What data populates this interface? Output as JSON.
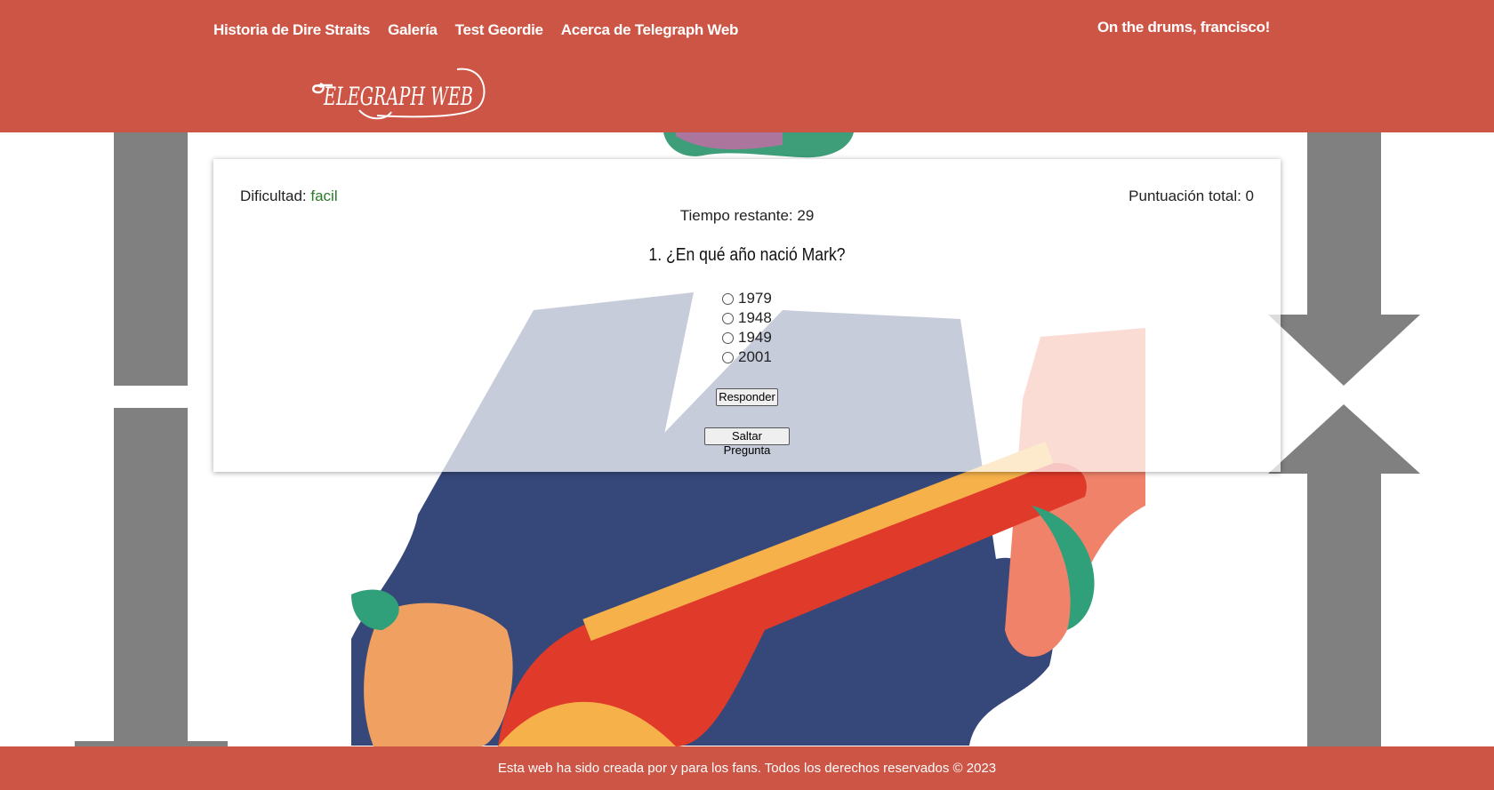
{
  "nav": {
    "items": [
      "Historia de Dire Straits",
      "Galería",
      "Test Geordie",
      "Acerca de Telegraph Web"
    ]
  },
  "header": {
    "greeting": "On the drums, francisco!",
    "logo_text": "Telegraph Web"
  },
  "quiz": {
    "difficulty_label": "Dificultad:",
    "difficulty_value": "facil",
    "score_label": "Puntuación total: 0",
    "timer_label": "Tiempo restante: 29",
    "question": "1. ¿En qué año nació Mark?",
    "options": [
      "1979",
      "1948",
      "1949",
      "2001"
    ],
    "answer_button": "Responder",
    "skip_button": "Saltar Pregunta"
  },
  "footer": {
    "text": "Esta web ha sido creada por y para los fans. Todos los derechos reservados © 2023"
  },
  "colors": {
    "brand": "#cd5545",
    "difficulty": "#2a7a2a"
  }
}
